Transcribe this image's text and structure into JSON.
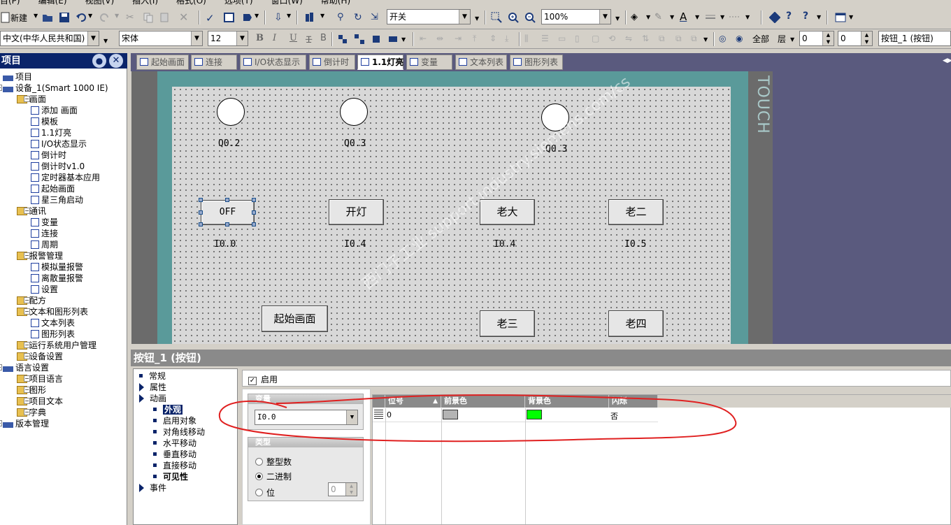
{
  "menubar": {
    "items": [
      "目(P)",
      "编辑(E)",
      "视图(V)",
      "插入(I)",
      "格式(O)",
      "选项(T)",
      "窗口(W)",
      "帮助(H)"
    ]
  },
  "toolbar1": {
    "new_label": "新建",
    "switch_combo": "开关",
    "zoom_combo": "100%"
  },
  "toolbar2": {
    "language_combo": "中文(中华人民共和国)",
    "font_combo": "宋体",
    "size_combo": "12",
    "all_label": "全部",
    "layer_label": "层",
    "layer_value_1": "0",
    "layer_value_2": "0",
    "object_combo": "按钮_1 (按钮)"
  },
  "tree": {
    "title": "项目",
    "items": [
      {
        "label": "项目",
        "level": 0
      },
      {
        "label": "设备_1(Smart 1000 IE)",
        "level": 0
      },
      {
        "label": "画面",
        "level": 1
      },
      {
        "label": "添加 画面",
        "level": 2
      },
      {
        "label": "模板",
        "level": 2
      },
      {
        "label": "1.1灯亮",
        "level": 2
      },
      {
        "label": "I/O状态显示",
        "level": 2
      },
      {
        "label": "倒计时",
        "level": 2
      },
      {
        "label": "倒计时v1.0",
        "level": 2
      },
      {
        "label": "定时器基本应用",
        "level": 2
      },
      {
        "label": "起始画面",
        "level": 2
      },
      {
        "label": "星三角启动",
        "level": 2
      },
      {
        "label": "通讯",
        "level": 1
      },
      {
        "label": "变量",
        "level": 2
      },
      {
        "label": "连接",
        "level": 2
      },
      {
        "label": "周期",
        "level": 2
      },
      {
        "label": "报警管理",
        "level": 1
      },
      {
        "label": "模拟量报警",
        "level": 2
      },
      {
        "label": "离散量报警",
        "level": 2
      },
      {
        "label": "设置",
        "level": 2
      },
      {
        "label": "配方",
        "level": 1
      },
      {
        "label": "文本和图形列表",
        "level": 1
      },
      {
        "label": "文本列表",
        "level": 2
      },
      {
        "label": "图形列表",
        "level": 2
      },
      {
        "label": "运行系统用户管理",
        "level": 1
      },
      {
        "label": "设备设置",
        "level": 1
      },
      {
        "label": "语言设置",
        "level": 0
      },
      {
        "label": "项目语言",
        "level": 1
      },
      {
        "label": "图形",
        "level": 1
      },
      {
        "label": "项目文本",
        "level": 1
      },
      {
        "label": "字典",
        "level": 1
      },
      {
        "label": "版本管理",
        "level": 0
      }
    ]
  },
  "tabs": [
    "起始画面",
    "连接",
    "I/O状态显示",
    "倒计时",
    "1.1灯亮",
    "变量",
    "文本列表",
    "图形列表"
  ],
  "screen": {
    "lamps": [
      "Q0.2",
      "Q0.3",
      "Q0.3"
    ],
    "buttons": [
      {
        "text": "OFF",
        "addr": "I0.0"
      },
      {
        "text": "开灯",
        "addr": "I0.4"
      },
      {
        "text": "老大",
        "addr": "I0.4"
      },
      {
        "text": "老二",
        "addr": "I0.5"
      },
      {
        "text": "起始画面",
        "addr": ""
      },
      {
        "text": "老三",
        "addr": ""
      },
      {
        "text": "老四",
        "addr": ""
      }
    ],
    "brand": "TOUCH",
    "watermark": "西门子工业 support.industry.siemens.com/cs"
  },
  "properties": {
    "title": "按钮_1 (按钮)",
    "categories": [
      {
        "label": "常规",
        "type": "bullet"
      },
      {
        "label": "属性",
        "type": "arrow"
      },
      {
        "label": "动画",
        "type": "arrow"
      },
      {
        "label": "外观",
        "type": "sub-selected"
      },
      {
        "label": "启用对象",
        "type": "sub"
      },
      {
        "label": "对角线移动",
        "type": "sub"
      },
      {
        "label": "水平移动",
        "type": "sub"
      },
      {
        "label": "垂直移动",
        "type": "sub"
      },
      {
        "label": "直接移动",
        "type": "sub"
      },
      {
        "label": "可见性",
        "type": "sub-bold"
      },
      {
        "label": "事件",
        "type": "arrow"
      }
    ],
    "enable_label": "启用",
    "variable_group": "变量",
    "variable_value": "I0.0",
    "type_group": "类型",
    "type_options": [
      "整型数",
      "二进制",
      "位"
    ],
    "type_selected": "二进制",
    "bit_value": "0",
    "grid_headers": [
      "位号",
      "前景色",
      "背景色",
      "闪烁"
    ],
    "grid_row": {
      "bit": "0",
      "flash": "否"
    },
    "colors": {
      "foreground": "#b4b4b4",
      "background": "#00ff00"
    }
  }
}
